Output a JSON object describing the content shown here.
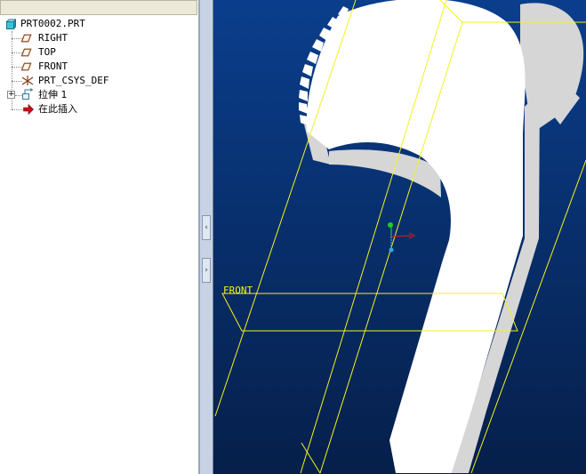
{
  "model_tree": {
    "root": {
      "label": "PRT0002.PRT",
      "icon": "part-icon"
    },
    "items": [
      {
        "label": "RIGHT",
        "icon": "datum-plane-icon"
      },
      {
        "label": "TOP",
        "icon": "datum-plane-icon"
      },
      {
        "label": "FRONT",
        "icon": "datum-plane-icon"
      },
      {
        "label": "PRT_CSYS_DEF",
        "icon": "coordinate-system-icon"
      },
      {
        "label": "拉伸 1",
        "icon": "extrude-feature-icon",
        "expander": "+"
      },
      {
        "label": "在此插入",
        "icon": "insert-here-arrow-icon"
      }
    ]
  },
  "splitter": {
    "collapse_glyph": "‹",
    "expand_glyph": "›"
  },
  "viewport": {
    "datum_label": "FRONT",
    "colors": {
      "background_top": "#0a3e8c",
      "background_bottom": "#061f4a",
      "datum_plane": "#f2f21c",
      "part_face": "#ffffff",
      "part_side": "#d6d6d6",
      "csys_x": "#c02020",
      "csys_y": "#22cc22",
      "csys_z": "#33aaee"
    }
  }
}
